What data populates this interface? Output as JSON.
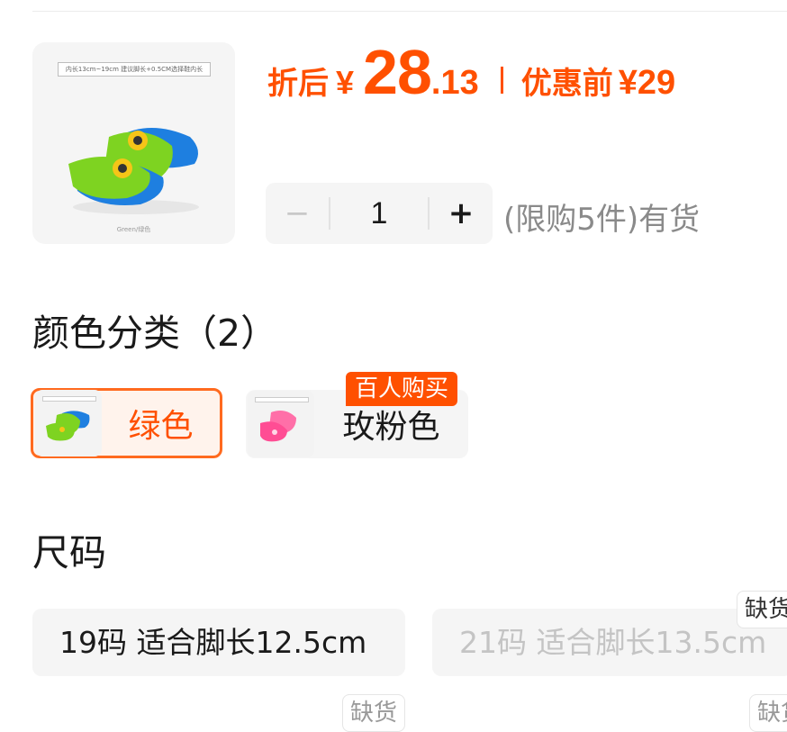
{
  "product": {
    "thumb_size_note": "内长13cm~19cm   建议脚长+0.5CM选择鞋内长",
    "thumb_caption": "Green/绿色"
  },
  "price": {
    "after_label": "折后",
    "currency": "¥",
    "integer": "28",
    "decimal": ".13",
    "before_label": "优惠前",
    "original": "¥29"
  },
  "quantity": {
    "minus": "−",
    "value": "1",
    "plus": "+",
    "stock_text": "(限购5件)有货"
  },
  "color_section": {
    "title": "颜色分类（2）",
    "options": [
      {
        "label": "绿色",
        "selected": true
      },
      {
        "label": "玫粉色",
        "selected": false,
        "badge": "百人购买"
      }
    ]
  },
  "size_section": {
    "title": "尺码",
    "options": [
      {
        "label": "19码 适合脚长12.5cm",
        "available": true
      },
      {
        "label": "21码 适合脚长13.5cm",
        "available": false
      }
    ],
    "soldout_label": "缺货"
  },
  "colors": {
    "accent": "#ff5000",
    "selected_bg": "#fff3ec",
    "chip_bg": "#f5f5f5"
  }
}
